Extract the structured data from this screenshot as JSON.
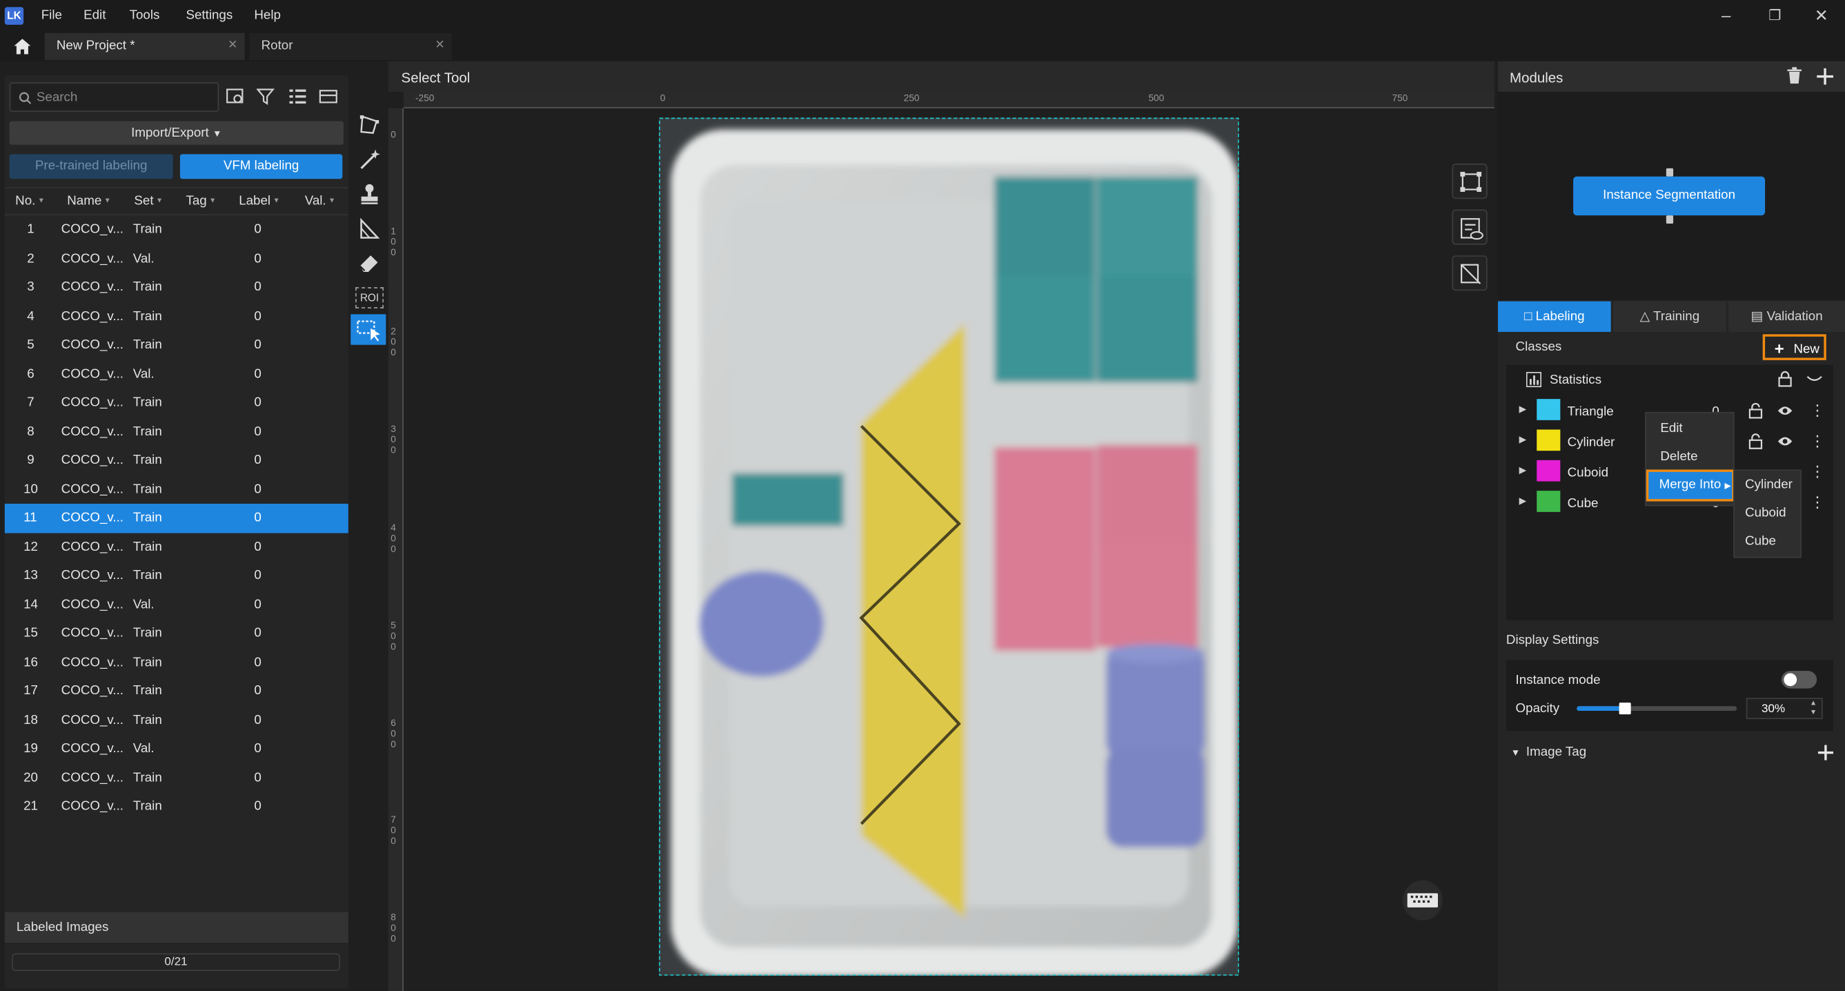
{
  "menu": [
    "File",
    "Edit",
    "Tools",
    "Settings",
    "Help"
  ],
  "app_logo": "LK",
  "tabs": [
    {
      "label": "New Project *",
      "active": true
    },
    {
      "label": "Rotor",
      "active": false
    }
  ],
  "left_panel": {
    "search_placeholder": "Search",
    "import_export": "Import/Export",
    "pretrained_btn": "Pre-trained labeling",
    "vfm_btn": "VFM labeling",
    "columns": [
      "No.",
      "Name",
      "Set",
      "Tag",
      "Label",
      "Val."
    ],
    "selected_row": 11,
    "rows": [
      {
        "no": "1",
        "name": "COCO_v...",
        "set": "Train",
        "label": "0"
      },
      {
        "no": "2",
        "name": "COCO_v...",
        "set": "Val.",
        "label": "0"
      },
      {
        "no": "3",
        "name": "COCO_v...",
        "set": "Train",
        "label": "0"
      },
      {
        "no": "4",
        "name": "COCO_v...",
        "set": "Train",
        "label": "0"
      },
      {
        "no": "5",
        "name": "COCO_v...",
        "set": "Train",
        "label": "0"
      },
      {
        "no": "6",
        "name": "COCO_v...",
        "set": "Val.",
        "label": "0"
      },
      {
        "no": "7",
        "name": "COCO_v...",
        "set": "Train",
        "label": "0"
      },
      {
        "no": "8",
        "name": "COCO_v...",
        "set": "Train",
        "label": "0"
      },
      {
        "no": "9",
        "name": "COCO_v...",
        "set": "Train",
        "label": "0"
      },
      {
        "no": "10",
        "name": "COCO_v...",
        "set": "Train",
        "label": "0"
      },
      {
        "no": "11",
        "name": "COCO_v...",
        "set": "Train",
        "label": "0"
      },
      {
        "no": "12",
        "name": "COCO_v...",
        "set": "Train",
        "label": "0"
      },
      {
        "no": "13",
        "name": "COCO_v...",
        "set": "Train",
        "label": "0"
      },
      {
        "no": "14",
        "name": "COCO_v...",
        "set": "Val.",
        "label": "0"
      },
      {
        "no": "15",
        "name": "COCO_v...",
        "set": "Train",
        "label": "0"
      },
      {
        "no": "16",
        "name": "COCO_v...",
        "set": "Train",
        "label": "0"
      },
      {
        "no": "17",
        "name": "COCO_v...",
        "set": "Train",
        "label": "0"
      },
      {
        "no": "18",
        "name": "COCO_v...",
        "set": "Train",
        "label": "0"
      },
      {
        "no": "19",
        "name": "COCO_v...",
        "set": "Val.",
        "label": "0"
      },
      {
        "no": "20",
        "name": "COCO_v...",
        "set": "Train",
        "label": "0"
      },
      {
        "no": "21",
        "name": "COCO_v...",
        "set": "Train",
        "label": "0"
      }
    ],
    "labeled_header": "Labeled Images",
    "progress_text": "0/21"
  },
  "canvas": {
    "tool_title": "Select Tool",
    "roi_label": "ROI",
    "ruler_h": [
      "-250",
      "0",
      "250",
      "500",
      "750"
    ],
    "ruler_v": [
      "0",
      "1 0 0",
      "2 0 0",
      "3 0 0",
      "4 0 0",
      "5 0 0",
      "6 0 0",
      "7 0 0",
      "8 0 0"
    ]
  },
  "right_panel": {
    "modules_title": "Modules",
    "module_name": "Instance Segmentation",
    "tabs": [
      {
        "label": "Labeling",
        "active": true
      },
      {
        "label": "Training",
        "active": false
      },
      {
        "label": "Validation",
        "active": false
      }
    ],
    "classes_label": "Classes",
    "new_label": "New",
    "statistics_label": "Statistics",
    "classes": [
      {
        "name": "Triangle",
        "color": "#35c6ee",
        "count": "0"
      },
      {
        "name": "Cylinder",
        "color": "#f2e013",
        "count": ""
      },
      {
        "name": "Cuboid",
        "color": "#e61fd7",
        "count": ""
      },
      {
        "name": "Cube",
        "color": "#3fb84a",
        "count": "0"
      }
    ],
    "context_menu": [
      "Edit",
      "Delete",
      "Merge Into"
    ],
    "merge_submenu": [
      "Cylinder",
      "Cuboid",
      "Cube"
    ],
    "display_settings": "Display Settings",
    "instance_mode": "Instance mode",
    "opacity_label": "Opacity",
    "opacity_value": "30%",
    "opacity_fraction": 0.3,
    "image_tag": "Image Tag"
  },
  "colors": {
    "accent": "#1f86e0",
    "highlight": "#f08a10"
  }
}
